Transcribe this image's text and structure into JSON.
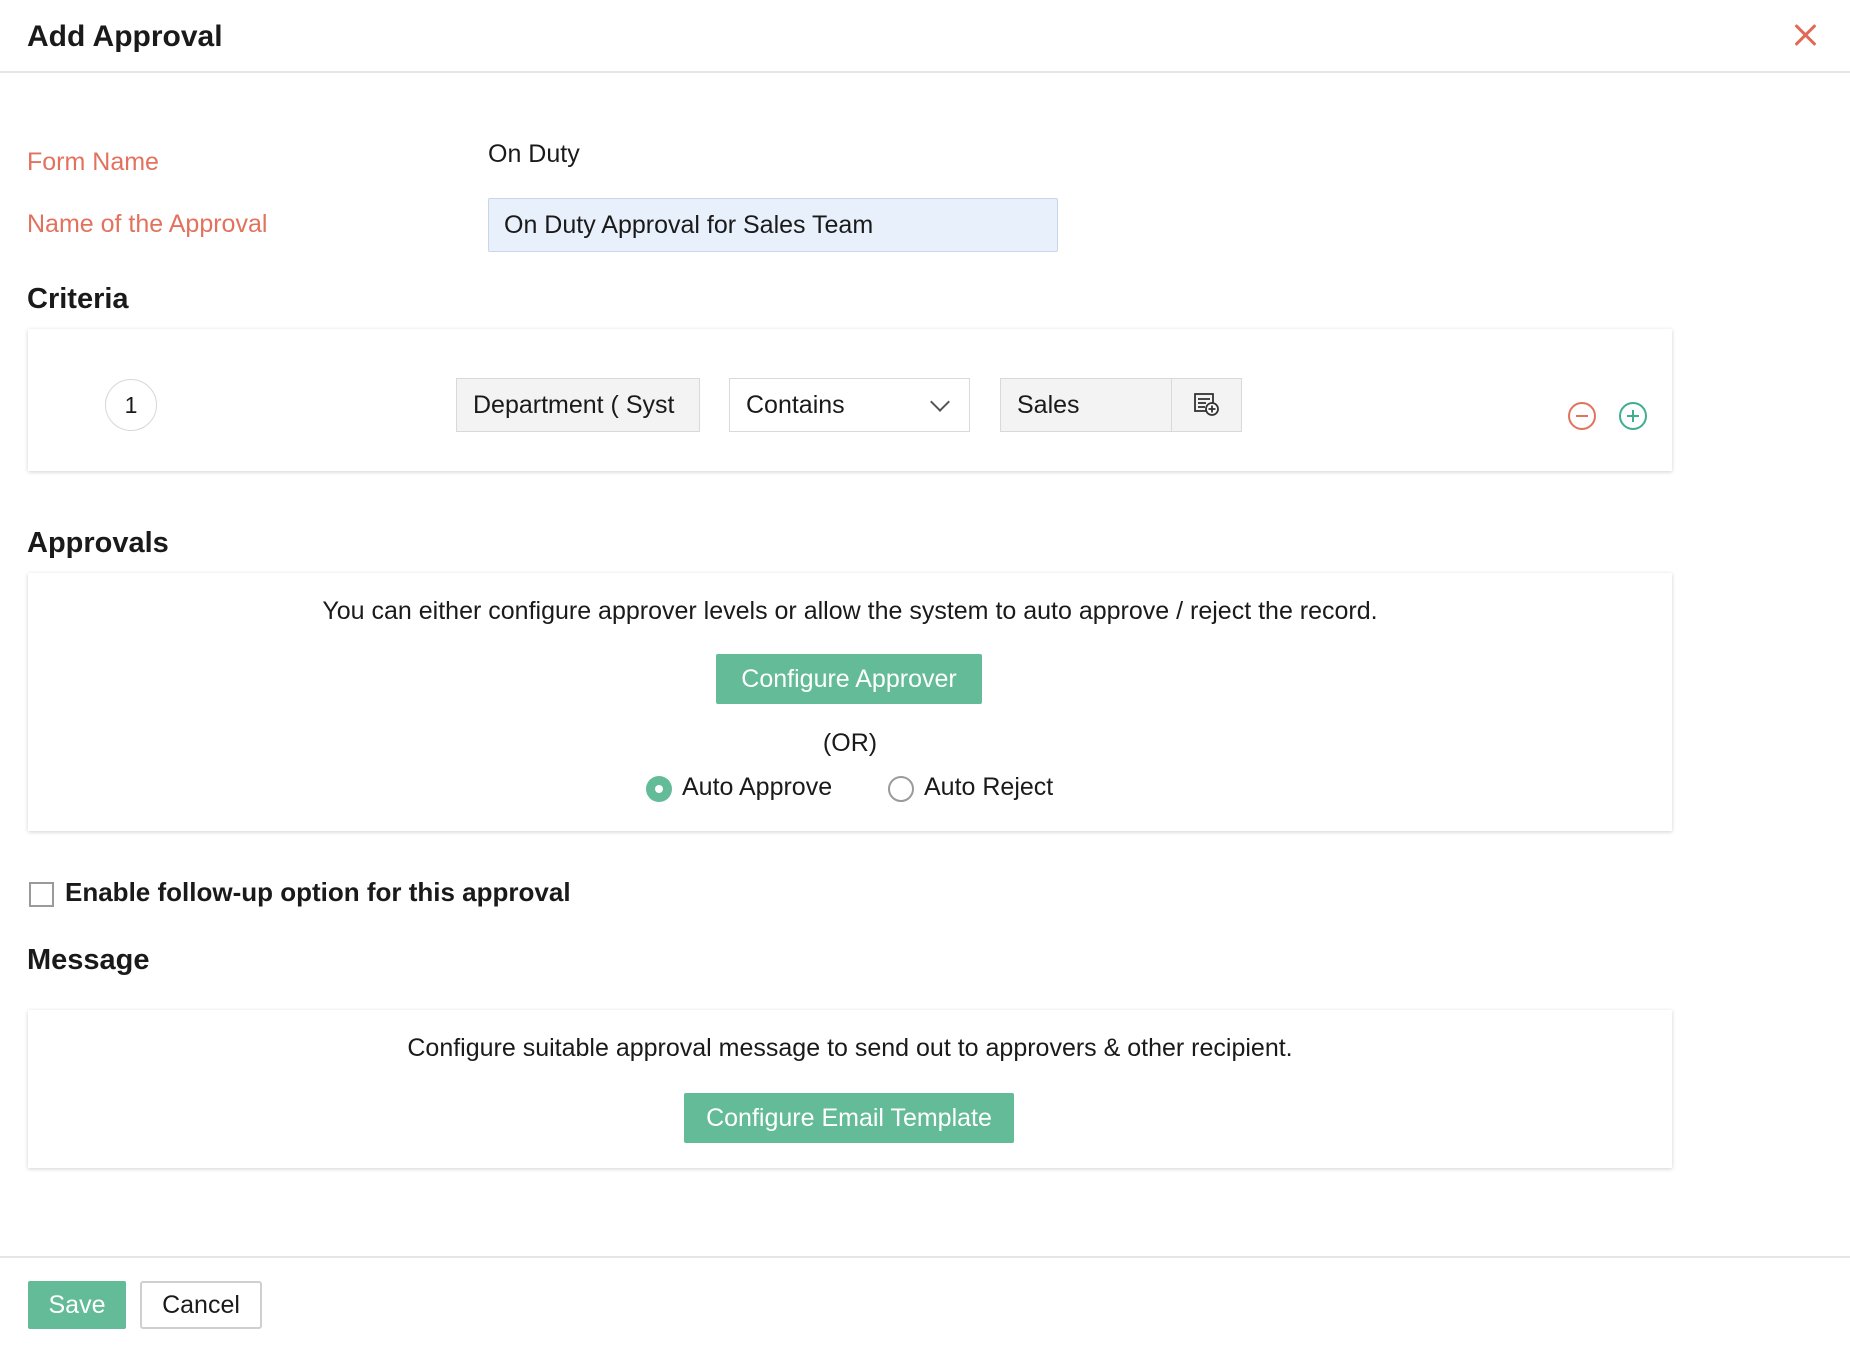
{
  "dialog": {
    "title": "Add Approval"
  },
  "form": {
    "form_name_label": "Form Name",
    "form_name_value": "On Duty",
    "approval_name_label": "Name of the Approval",
    "approval_name_value": "On Duty Approval for Sales Team"
  },
  "criteria": {
    "title": "Criteria",
    "rows": [
      {
        "number": "1",
        "field": "Department ( Syst",
        "operator": "Contains",
        "value": "Sales"
      }
    ]
  },
  "approvals": {
    "title": "Approvals",
    "description": "You can either configure approver levels or allow the system to auto approve / reject the record.",
    "configure_button": "Configure Approver",
    "or_text": "(OR)",
    "options": [
      {
        "label": "Auto Approve",
        "selected": true
      },
      {
        "label": "Auto Reject",
        "selected": false
      }
    ]
  },
  "followup": {
    "label": "Enable follow-up option for this approval",
    "checked": false
  },
  "message": {
    "title": "Message",
    "description": "Configure suitable approval message to send out to approvers & other recipient.",
    "configure_button": "Configure Email Template"
  },
  "footer": {
    "save_label": "Save",
    "cancel_label": "Cancel"
  },
  "colors": {
    "accent_green": "#63bb98",
    "label_red": "#e2725e",
    "input_blue": "#e8f0fc"
  },
  "icons": {
    "close": "close-icon",
    "dropdown": "chevron-down-icon",
    "lookup": "lookup-list-icon",
    "remove": "minus-circle-icon",
    "add": "plus-circle-icon"
  }
}
